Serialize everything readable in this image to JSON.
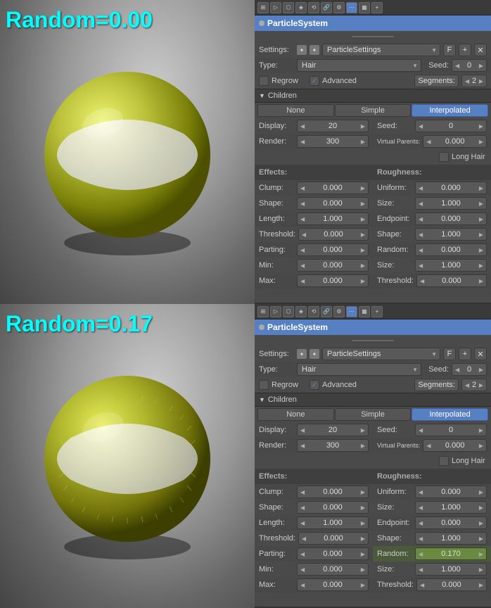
{
  "panels": [
    {
      "id": "top",
      "label": "Random=0.00",
      "system_name": "ParticleSystem",
      "settings_label": "ParticleSettings",
      "type_label": "Type:",
      "type_value": "Hair",
      "seed_label": "Seed:",
      "seed_value": "0",
      "regrow_label": "Regrow",
      "advanced_label": "Advanced",
      "segments_label": "Segments:",
      "segments_value": "2",
      "children_section": "Children",
      "tab_none": "None",
      "tab_simple": "Simple",
      "tab_interpolated": "Interpolated",
      "display_label": "Display:",
      "display_value": "20",
      "render_label": "Render:",
      "render_value": "300",
      "seed2_label": "Seed:",
      "seed2_value": "0",
      "virtual_parents_label": "Virtual Parents:",
      "virtual_parents_value": "0.000",
      "long_hair_label": "Long Hair",
      "effects_label": "Effects:",
      "roughness_label": "Roughness:",
      "clump_label": "Clump:",
      "clump_value": "0.000",
      "uniform_label": "Uniform:",
      "uniform_value": "0.000",
      "shape_label": "Shape:",
      "shape_value": "0.000",
      "size_label": "Size:",
      "size_value": "1.000",
      "length_label": "Length:",
      "length_value": "1.000",
      "endpoint_label": "Endpoint:",
      "endpoint_value": "0.000",
      "threshold_label": "Threshold:",
      "threshold_value": "0.000",
      "shape2_label": "Shape:",
      "shape2_value": "1.000",
      "parting_label": "Parting:",
      "parting_value": "0.000",
      "random_label": "Random:",
      "random_value": "0.000",
      "min_label": "Min:",
      "min_value": "0.000",
      "size2_label": "Size:",
      "size2_value": "1.000",
      "max_label": "Max:",
      "max_value": "0.000",
      "threshold2_label": "Threshold:",
      "threshold2_value": "0.000"
    },
    {
      "id": "bottom",
      "label": "Random=0.17",
      "system_name": "ParticleSystem",
      "settings_label": "ParticleSettings",
      "type_label": "Type:",
      "type_value": "Hair",
      "seed_label": "Seed:",
      "seed_value": "0",
      "regrow_label": "Regrow",
      "advanced_label": "Advanced",
      "segments_label": "Segments:",
      "segments_value": "2",
      "children_section": "Children",
      "tab_none": "None",
      "tab_simple": "Simple",
      "tab_interpolated": "Interpolated",
      "display_label": "Display:",
      "display_value": "20",
      "render_label": "Render:",
      "render_value": "300",
      "seed2_label": "Seed:",
      "seed2_value": "0",
      "virtual_parents_label": "Virtual Parents:",
      "virtual_parents_value": "0.000",
      "long_hair_label": "Long Hair",
      "effects_label": "Effects:",
      "roughness_label": "Roughness:",
      "clump_label": "Clump:",
      "clump_value": "0.000",
      "uniform_label": "Uniform:",
      "uniform_value": "0.000",
      "shape_label": "Shape:",
      "shape_value": "0.000",
      "size_label": "Size:",
      "size_value": "1.000",
      "length_label": "Length:",
      "length_value": "1.000",
      "endpoint_label": "Endpoint:",
      "endpoint_value": "0.000",
      "threshold_label": "Threshold:",
      "threshold_value": "0.000",
      "shape2_label": "Shape:",
      "shape2_value": "1.000",
      "parting_label": "Parting:",
      "parting_value": "0.000",
      "random_label": "Random:",
      "random_value": "0.170",
      "min_label": "Min:",
      "min_value": "0.000",
      "size2_label": "Size:",
      "size2_value": "1.000",
      "max_label": "Max:",
      "max_value": "0.000",
      "threshold2_label": "Threshold:",
      "threshold2_value": "0.000"
    }
  ]
}
